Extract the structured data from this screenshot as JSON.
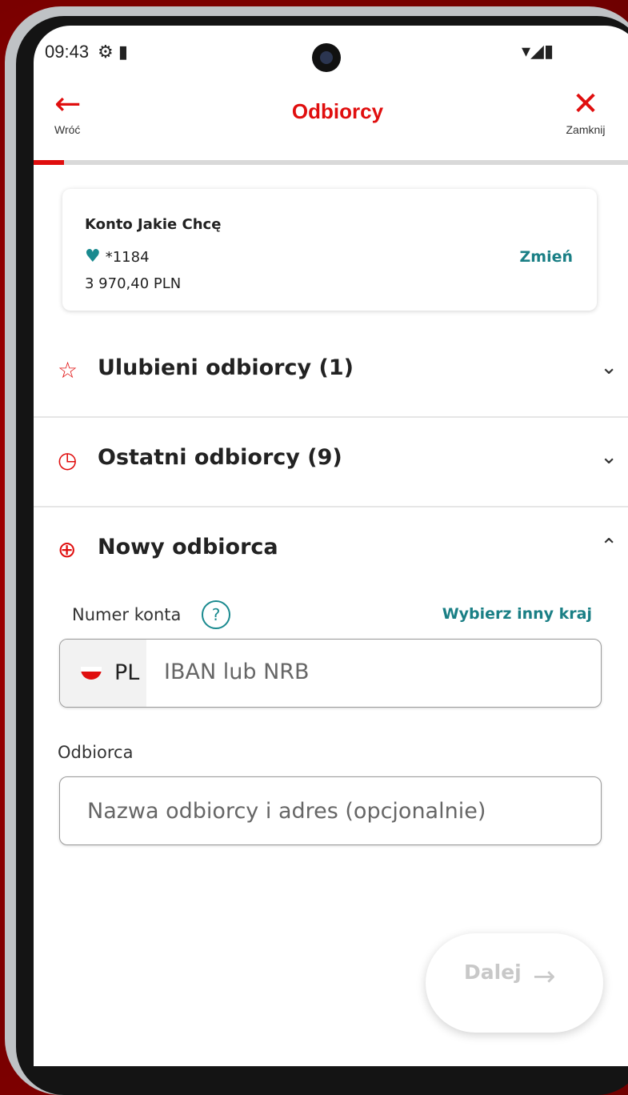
{
  "status": {
    "time": "09:43",
    "icons_left": "⚙ ▮",
    "icons_right": "▾◢▮"
  },
  "header": {
    "back_label": "Wróć",
    "title": "Odbiorcy",
    "close_label": "Zamknij"
  },
  "progress": {
    "fraction": 0.05,
    "color": "#e00e0e"
  },
  "account": {
    "name": "Konto Jakie Chcę",
    "number": "*1184",
    "balance": "3 970,40 PLN",
    "change_label": "Zmień"
  },
  "sections": [
    {
      "icon": "star-outline-icon",
      "label": "Ulubieni odbiorcy (1)",
      "expanded": false
    },
    {
      "icon": "history-clock-icon",
      "label": "Ostatni odbiorcy (9)",
      "expanded": false
    },
    {
      "icon": "add-circle-icon",
      "label": "Nowy odbiorca",
      "expanded": true
    }
  ],
  "new_recipient": {
    "account_label": "Numer konta",
    "other_country": "Wybierz inny kraj",
    "country_code": "PL",
    "iban_placeholder": "IBAN lub NRB",
    "recipient_label": "Odbiorca",
    "recipient_placeholder": "Nazwa odbiorcy i adres (opcjonalnie)"
  },
  "next_button": {
    "label": "Dalej",
    "enabled": false
  },
  "colors": {
    "brand_red": "#e00e0e",
    "teal": "#1a7f85"
  }
}
